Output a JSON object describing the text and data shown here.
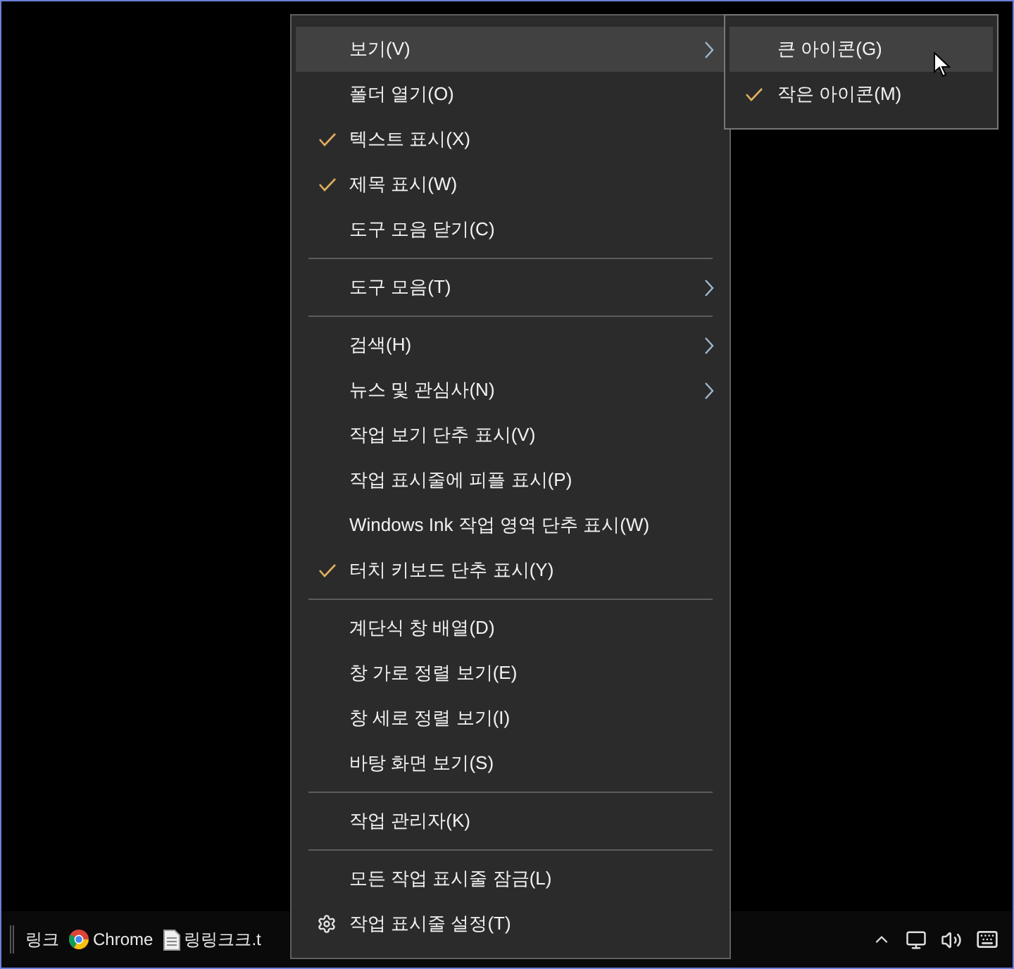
{
  "context_menu": {
    "sections": [
      {
        "items": [
          {
            "label": "보기(V)",
            "kind": "item",
            "checked": false,
            "submenu": true,
            "selected": true
          },
          {
            "label": "폴더 열기(O)",
            "kind": "item",
            "checked": false,
            "submenu": false,
            "selected": false
          },
          {
            "label": "텍스트 표시(X)",
            "kind": "item",
            "checked": true,
            "submenu": false,
            "selected": false
          },
          {
            "label": "제목 표시(W)",
            "kind": "item",
            "checked": true,
            "submenu": false,
            "selected": false
          },
          {
            "label": "도구 모음 닫기(C)",
            "kind": "item",
            "checked": false,
            "submenu": false,
            "selected": false
          }
        ]
      },
      {
        "items": [
          {
            "label": "도구 모음(T)",
            "kind": "item",
            "checked": false,
            "submenu": true,
            "selected": false
          }
        ]
      },
      {
        "items": [
          {
            "label": "검색(H)",
            "kind": "item",
            "checked": false,
            "submenu": true,
            "selected": false
          },
          {
            "label": "뉴스 및 관심사(N)",
            "kind": "item",
            "checked": false,
            "submenu": true,
            "selected": false
          },
          {
            "label": "작업 보기 단추 표시(V)",
            "kind": "item",
            "checked": false,
            "submenu": false,
            "selected": false
          },
          {
            "label": "작업 표시줄에 피플 표시(P)",
            "kind": "item",
            "checked": false,
            "submenu": false,
            "selected": false
          },
          {
            "label": "Windows Ink 작업 영역 단추 표시(W)",
            "kind": "item",
            "checked": false,
            "submenu": false,
            "selected": false
          },
          {
            "label": "터치 키보드 단추 표시(Y)",
            "kind": "item",
            "checked": true,
            "submenu": false,
            "selected": false
          }
        ]
      },
      {
        "items": [
          {
            "label": "계단식 창 배열(D)",
            "kind": "item",
            "checked": false,
            "submenu": false,
            "selected": false
          },
          {
            "label": "창 가로 정렬 보기(E)",
            "kind": "item",
            "checked": false,
            "submenu": false,
            "selected": false
          },
          {
            "label": "창 세로 정렬 보기(I)",
            "kind": "item",
            "checked": false,
            "submenu": false,
            "selected": false
          },
          {
            "label": "바탕 화면 보기(S)",
            "kind": "item",
            "checked": false,
            "submenu": false,
            "selected": false
          }
        ]
      },
      {
        "items": [
          {
            "label": "작업 관리자(K)",
            "kind": "item",
            "checked": false,
            "submenu": false,
            "selected": false
          }
        ]
      },
      {
        "items": [
          {
            "label": "모든 작업 표시줄 잠금(L)",
            "kind": "item",
            "checked": false,
            "submenu": false,
            "selected": false
          },
          {
            "label": "작업 표시줄 설정(T)",
            "kind": "settings",
            "checked": false,
            "submenu": false,
            "selected": false
          }
        ]
      }
    ]
  },
  "submenu": {
    "items": [
      {
        "label": "큰 아이콘(G)",
        "checked": false,
        "selected": true
      },
      {
        "label": "작은 아이콘(M)",
        "checked": true,
        "selected": false
      }
    ]
  },
  "taskbar": {
    "toolbar_label": "링크",
    "items": [
      {
        "label": "Chrome",
        "kind": "browser"
      },
      {
        "label": "링링크크.t",
        "kind": "document"
      }
    ]
  }
}
